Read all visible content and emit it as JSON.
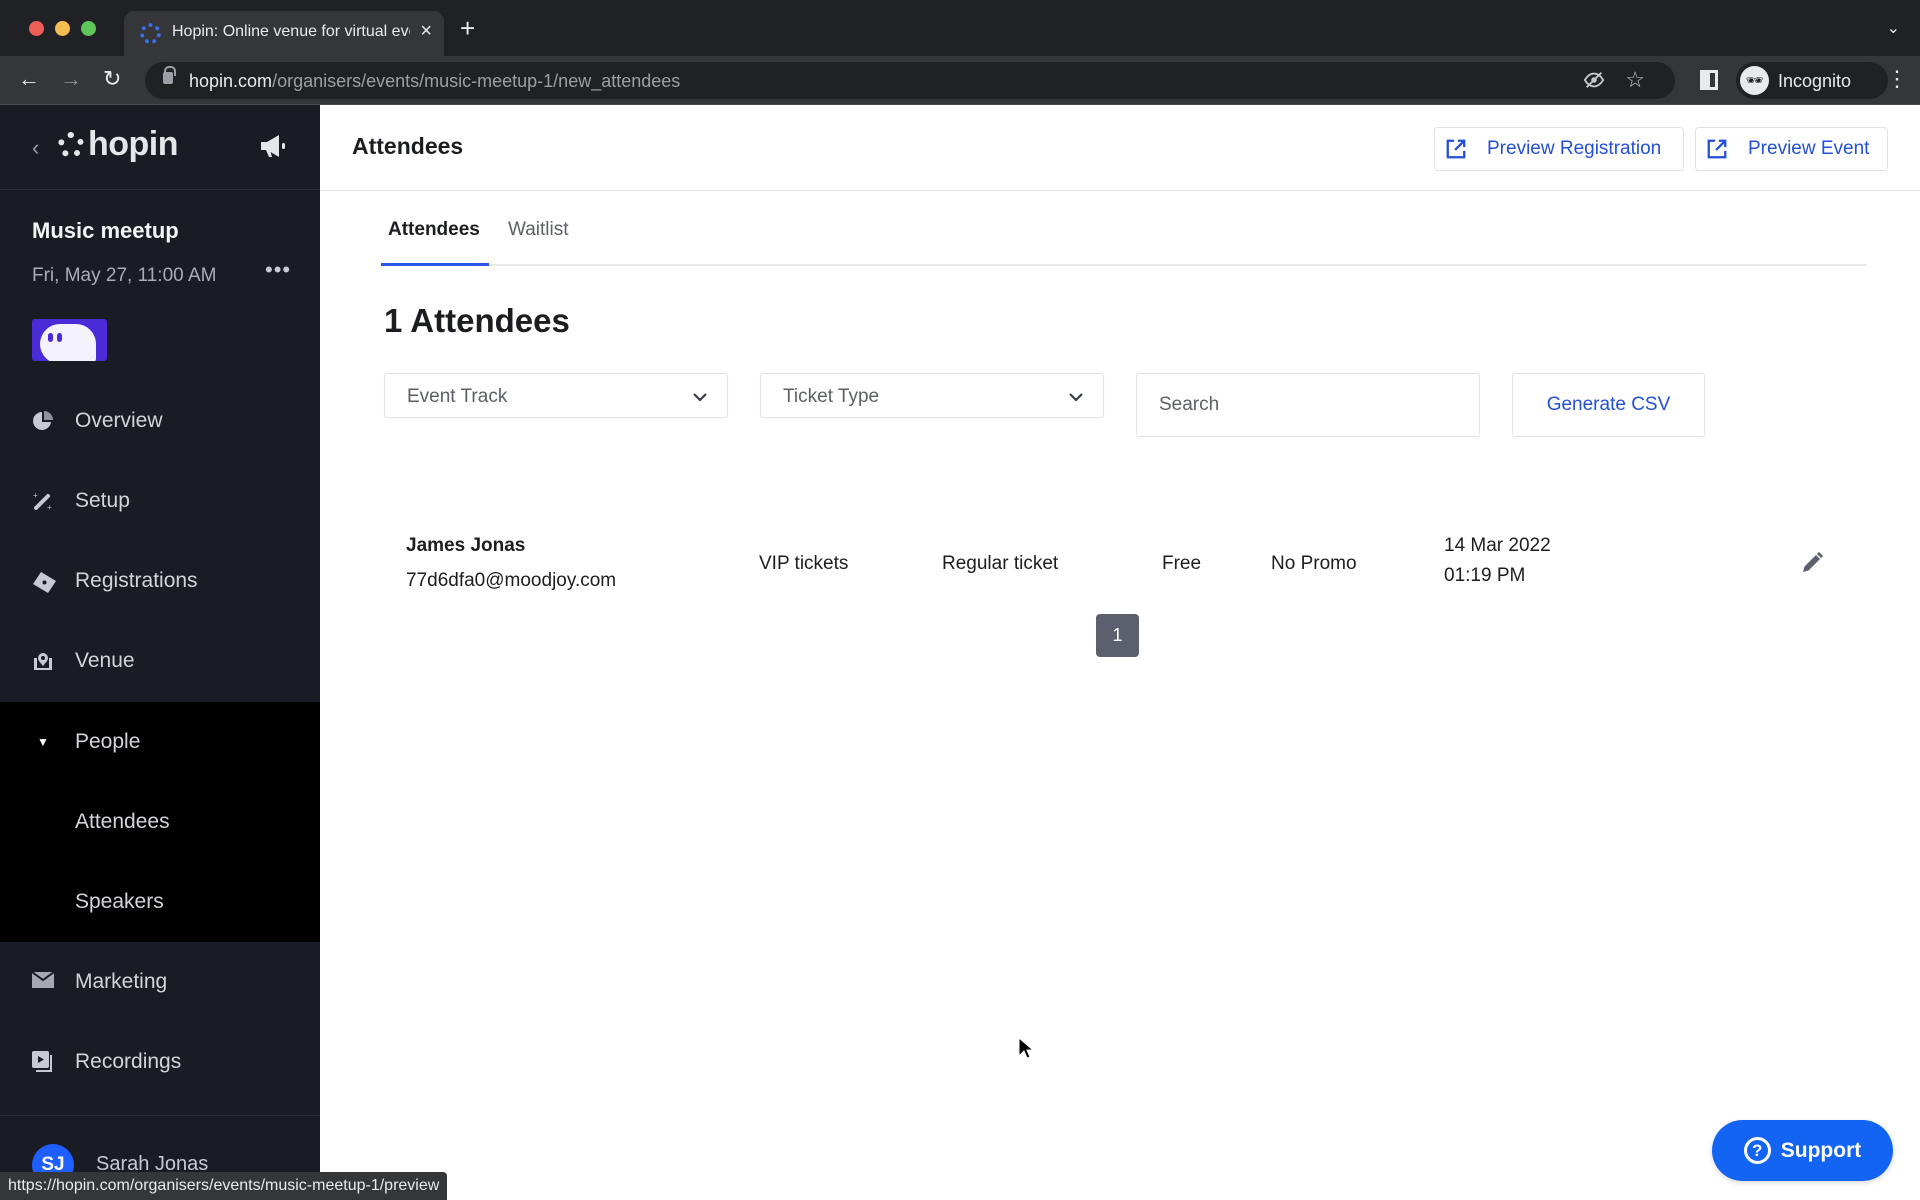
{
  "browser": {
    "tab_title": "Hopin: Online venue for virtual events",
    "url_host": "hopin.com",
    "url_path": "/organisers/events/music-meetup-1/new_attendees",
    "profile_label": "Incognito",
    "status_url": "https://hopin.com/organisers/events/music-meetup-1/preview"
  },
  "sidebar": {
    "brand": "hopin",
    "event": {
      "name": "Music meetup",
      "date": "Fri, May 27, 11:00 AM",
      "more": "•••"
    },
    "items": [
      {
        "label": "Overview",
        "icon": "pie-chart-icon"
      },
      {
        "label": "Setup",
        "icon": "magic-wand-icon"
      },
      {
        "label": "Registrations",
        "icon": "ticket-icon"
      },
      {
        "label": "Venue",
        "icon": "venue-pin-icon"
      },
      {
        "label": "People",
        "icon": "caret-down-icon",
        "expanded": true
      },
      {
        "label": "Attendees",
        "sub": true,
        "active": true
      },
      {
        "label": "Speakers",
        "sub": true
      },
      {
        "label": "Marketing",
        "icon": "mail-icon"
      },
      {
        "label": "Recordings",
        "icon": "recordings-icon"
      }
    ],
    "user": {
      "initials": "SJ",
      "name": "Sarah Jonas"
    }
  },
  "header": {
    "title": "Attendees",
    "preview_registration": "Preview Registration",
    "preview_event": "Preview Event"
  },
  "tabs": [
    {
      "label": "Attendees",
      "active": true
    },
    {
      "label": "Waitlist",
      "active": false
    }
  ],
  "count_title": "1 Attendees",
  "filters": {
    "event_track_placeholder": "Event Track",
    "ticket_type_placeholder": "Ticket Type",
    "search_placeholder": "Search",
    "search_value": "",
    "generate_csv": "Generate CSV"
  },
  "attendees": [
    {
      "name": "James Jonas",
      "email": "77d6dfa0@moodjoy.com",
      "track": "VIP tickets",
      "ticket": "Regular ticket",
      "price": "Free",
      "promo": "No Promo",
      "date": "14 Mar 2022",
      "time": "01:19 PM"
    }
  ],
  "pagination": {
    "current": "1"
  },
  "support_label": "Support",
  "colors": {
    "accent": "#2350d6",
    "sidebar_bg": "#1a1c23",
    "support_bg": "#1364f2",
    "avatar_bg": "#1f5fff"
  }
}
